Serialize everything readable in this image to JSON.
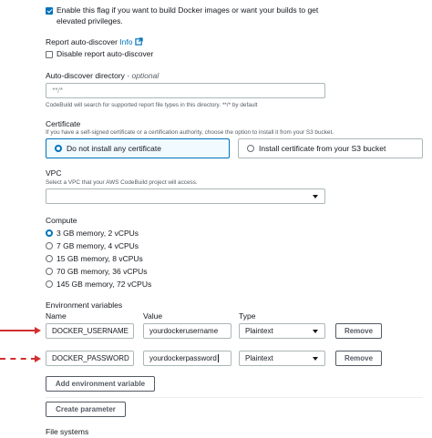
{
  "privileged": {
    "label_line1": "Enable this flag if you want to build Docker images or want your builds to get",
    "label_line2": "elevated privileges.",
    "checked": true
  },
  "report_auto_discover": {
    "title": "Report auto-discover",
    "info_label": "Info",
    "checkbox_label": "Disable report auto-discover",
    "checked": false
  },
  "auto_discover_dir": {
    "label": "Auto-discover directory",
    "optional": " - optional",
    "placeholder": "**/*",
    "hint": "CodeBuild will search for supported report file types in this directory. **/* by default"
  },
  "certificate": {
    "label": "Certificate",
    "hint": "If you have a self-signed certificate or a certification authority, choose the option to install it from your S3 bucket.",
    "options": [
      {
        "label": "Do not install any certificate",
        "selected": true
      },
      {
        "label": "Install certificate from your S3 bucket",
        "selected": false
      }
    ]
  },
  "vpc": {
    "label": "VPC",
    "hint": "Select a VPC that your AWS CodeBuild project will access.",
    "value": ""
  },
  "compute": {
    "label": "Compute",
    "options": [
      {
        "label": "3 GB memory, 2 vCPUs",
        "selected": true
      },
      {
        "label": "7 GB memory, 4 vCPUs",
        "selected": false
      },
      {
        "label": "15 GB memory, 8 vCPUs",
        "selected": false
      },
      {
        "label": "70 GB memory, 36 vCPUs",
        "selected": false
      },
      {
        "label": "145 GB memory, 72 vCPUs",
        "selected": false
      }
    ]
  },
  "env_vars": {
    "label": "Environment variables",
    "col_name": "Name",
    "col_value": "Value",
    "col_type": "Type",
    "rows": [
      {
        "name": "DOCKER_USERNAME",
        "value": "yourdockerusername",
        "type": "Plaintext",
        "remove": "Remove"
      },
      {
        "name": "DOCKER_PASSWORD",
        "value": "yourdockerpassword",
        "type": "Plaintext",
        "remove": "Remove"
      }
    ],
    "add_button": "Add environment variable"
  },
  "create_parameter": "Create parameter",
  "file_systems": "File systems",
  "colors": {
    "accent": "#0073bb",
    "annotation_arrow": "#d32f2f"
  },
  "icons": [
    "checkbox-checked-icon",
    "external-link-icon",
    "caret-down-icon",
    "red-arrow-annotation"
  ]
}
